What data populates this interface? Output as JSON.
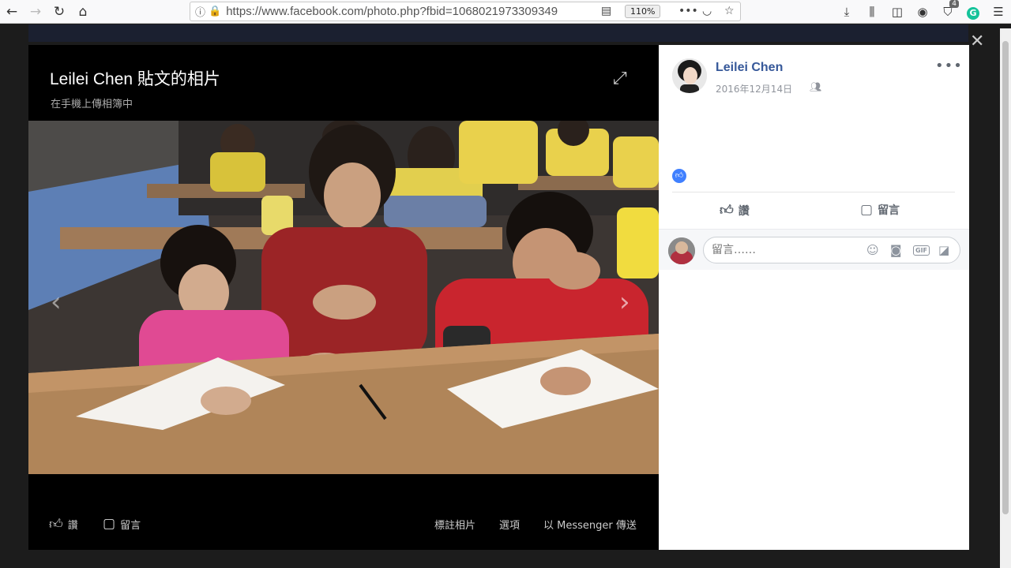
{
  "browser": {
    "url": "https://www.facebook.com/photo.php?fbid=1068021973309349",
    "zoom": "110%",
    "extension_badge": "4"
  },
  "photo": {
    "title": "Leilei Chen 貼文的相片",
    "subtitle": "在手機上傳相簿中",
    "actions": {
      "like": "讚",
      "comment": "留言",
      "tag": "標註相片",
      "options": "選項",
      "send": "以 Messenger 傳送"
    }
  },
  "post": {
    "author": "Leilei Chen",
    "date": "2016年12月14日",
    "reaction_count": "",
    "like_label": "讚",
    "comment_label": "留言",
    "comment_placeholder": "留言……"
  },
  "colors": {
    "link": "#365899",
    "like_blue": "#4080ff"
  }
}
